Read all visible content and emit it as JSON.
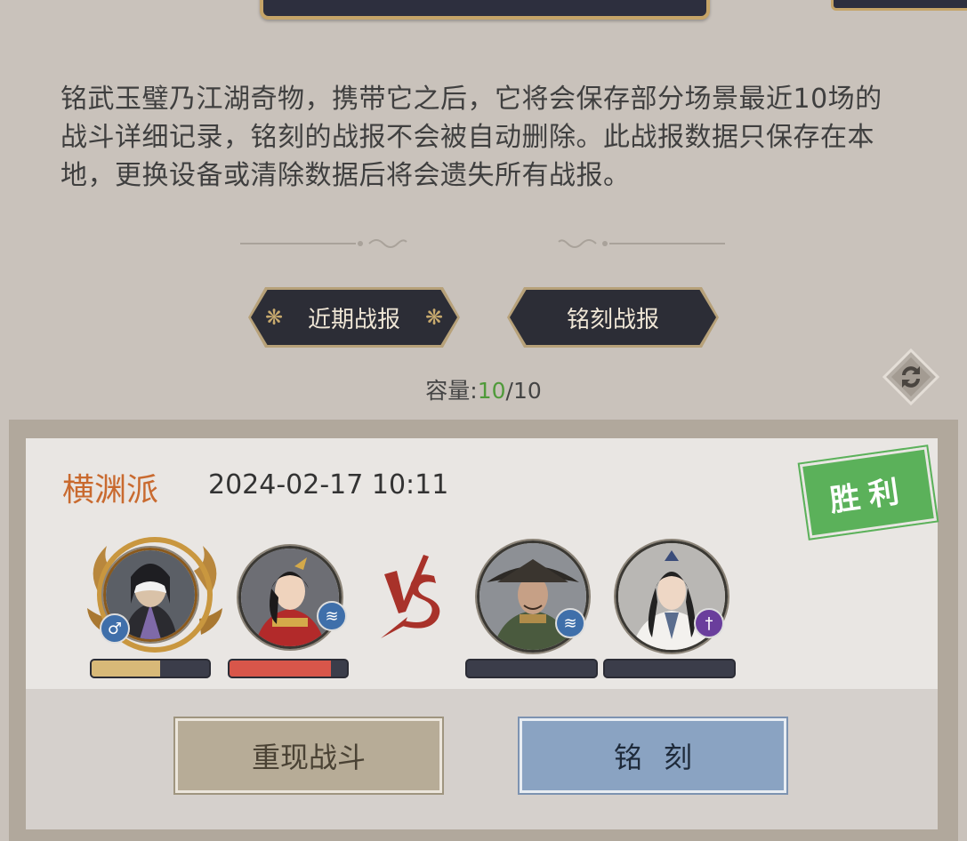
{
  "description": "铭武玉璧乃江湖奇物，携带它之后，它将会保存部分场景最近10场的战斗详细记录，铭刻的战报不会被自动删除。此战报数据只保存在本地，更换设备或清除数据后将会遗失所有战报。",
  "tabs": [
    {
      "label": "近期战报",
      "selected": true
    },
    {
      "label": "铭刻战报",
      "selected": false
    }
  ],
  "capacity": {
    "label": "容量:",
    "used": "10",
    "separator": "/",
    "total": "10"
  },
  "battle": {
    "sect": "横渊派",
    "datetime": "2024-02-17 10:11",
    "result": "胜利",
    "vs_icon": "vs-emblem",
    "allies": [
      {
        "name": "masked-swordsman",
        "badge": "male-icon",
        "hp": 0.58
      },
      {
        "name": "red-armor-heroine",
        "badge": "water-element-icon",
        "hp": 0.86
      }
    ],
    "enemies": [
      {
        "name": "straw-hat-warrior",
        "badge": "water-element-icon",
        "hp": 0.0
      },
      {
        "name": "white-robe-swordsman",
        "badge": "sword-element-icon",
        "hp": 0.0
      }
    ]
  },
  "buttons": {
    "replay": "重现战斗",
    "engrave": "铭刻"
  },
  "colors": {
    "sect": "#c96a2f",
    "capacity_used": "#4f9a3a",
    "victory": "#5bb15a",
    "hp_gold": "#d8b978",
    "hp_red": "#d8564a"
  }
}
